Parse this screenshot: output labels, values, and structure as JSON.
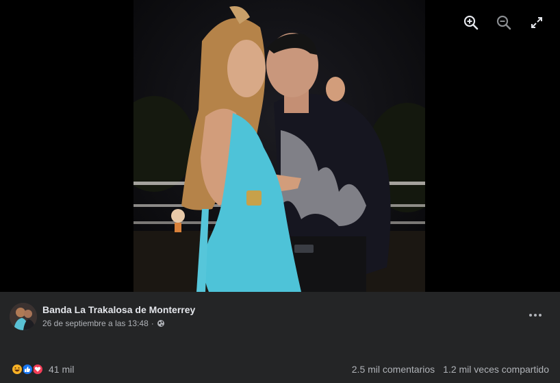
{
  "viewer": {
    "tools": [
      {
        "icon": "zoom-in-icon"
      },
      {
        "icon": "zoom-out-icon"
      },
      {
        "icon": "fullscreen-icon"
      }
    ]
  },
  "post": {
    "author": "Banda La Trakalosa de Monterrey",
    "timestamp": "26 de septiembre a las 13:48",
    "separator": "·",
    "audience_icon": "globe-icon",
    "reactions": {
      "icons": [
        "haha-icon",
        "like-icon",
        "love-icon"
      ],
      "count": "41 mil"
    },
    "comments": "2.5 mil comentarios",
    "shares": "1.2 mil veces compartido"
  },
  "colors": {
    "post_bg": "#242526",
    "primary_text": "#e4e6eb",
    "secondary_text": "#b0b3b8",
    "like": "#1877f2",
    "love": "#f33e58",
    "haha": "#f7b125"
  }
}
